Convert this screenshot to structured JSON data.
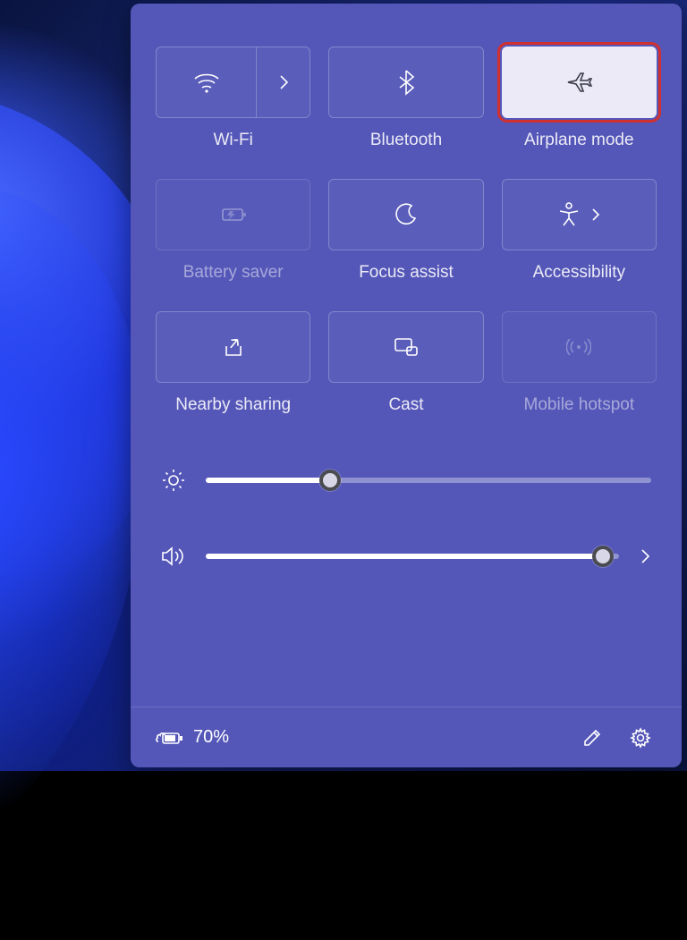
{
  "tiles": {
    "wifi": {
      "label": "Wi-Fi",
      "active": false,
      "has_arrow": true
    },
    "bluetooth": {
      "label": "Bluetooth",
      "active": false
    },
    "airplane": {
      "label": "Airplane mode",
      "active": true,
      "highlighted": true
    },
    "battery_saver": {
      "label": "Battery saver",
      "disabled": true
    },
    "focus_assist": {
      "label": "Focus assist",
      "active": false
    },
    "accessibility": {
      "label": "Accessibility",
      "active": false,
      "has_inline_arrow": true
    },
    "nearby": {
      "label": "Nearby sharing",
      "active": false
    },
    "cast": {
      "label": "Cast",
      "active": false
    },
    "hotspot": {
      "label": "Mobile hotspot",
      "disabled": true
    }
  },
  "sliders": {
    "brightness": {
      "value": 28
    },
    "volume": {
      "value": 96,
      "has_arrow": true
    }
  },
  "footer": {
    "battery_text": "70%",
    "charging": true
  },
  "colors": {
    "panel": "#5457b8",
    "tile_active_bg": "#eceaf6",
    "highlight": "#d03030"
  }
}
